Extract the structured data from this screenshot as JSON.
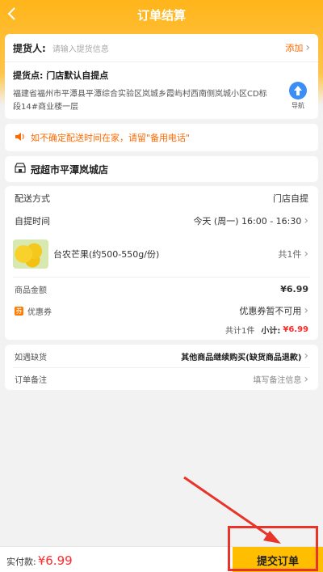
{
  "topbar": {
    "title": "订单结算"
  },
  "pickup": {
    "person_label": "提货人:",
    "person_placeholder": "请输入提货信息",
    "add_label": "添加",
    "point_label": "提货点: 门店默认自提点",
    "address_line1": "福建省福州市平潭县平潭综合实验区岚城乡霞屿村西南侧岚城小区CD标",
    "address_line2": "段14#商业楼一层",
    "nav_label": "导航"
  },
  "notice": {
    "text": "如不确定配送时间在家，请留\"备用电话\""
  },
  "store": {
    "name": "冠超市平潭岚城店"
  },
  "delivery": {
    "method_label": "配送方式",
    "method_value": "门店自提",
    "time_label": "自提时间",
    "time_value": "今天 (周一) 16:00 - 16:30"
  },
  "goods": {
    "name": "台农芒果(约500-550g/份)",
    "count": "共1件"
  },
  "amounts": {
    "goods_label": "商品金额",
    "goods_value": "¥6.99",
    "coupon_label": "优惠券",
    "coupon_badge": "券",
    "coupon_value": "优惠券暂不可用",
    "total_count": "共计1件",
    "subtotal_label": "小计:",
    "subtotal_value": "¥6.99"
  },
  "stock": {
    "label": "如遇缺货",
    "value": "其他商品继续购买(缺货商品退款)"
  },
  "remark": {
    "label": "订单备注",
    "placeholder": "填写备注信息"
  },
  "bottom": {
    "pay_label": "实付款:",
    "pay_value": "¥6.99",
    "submit_label": "提交订单"
  },
  "colors": {
    "accent": "#ffbf00",
    "price": "#ff2b2b",
    "notice": "#ff6a00",
    "annotation": "#e8342a"
  },
  "icons": [
    "back-icon",
    "chevron-right-icon",
    "navigation-icon",
    "speaker-icon",
    "store-icon",
    "coupon-icon"
  ]
}
